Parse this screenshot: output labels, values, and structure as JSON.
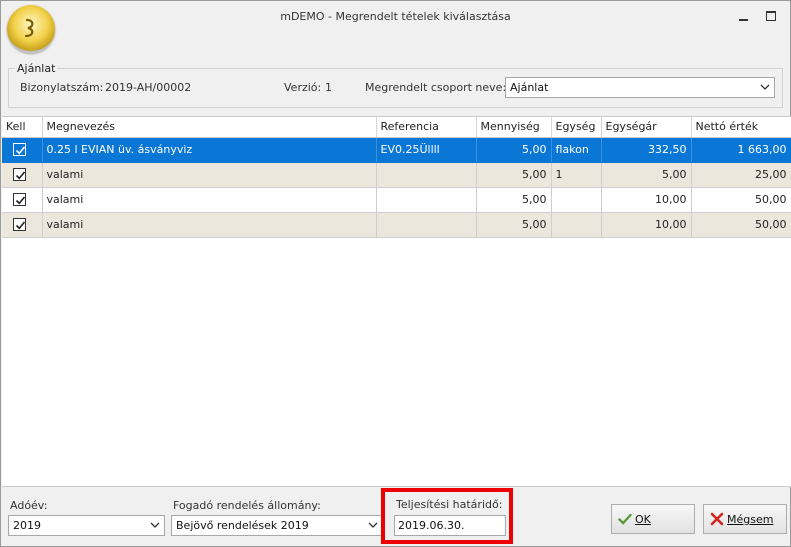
{
  "window": {
    "title": "mDEMO - Megrendelt tételek kiválasztása"
  },
  "offer": {
    "group_label": "Ajánlat",
    "doc_number_label": "Bizonylatszám:",
    "doc_number_value": "2019-AH/00002",
    "version_label": "Verzió:",
    "version_value": "1",
    "group_name_label": "Megrendelt csoport neve:",
    "group_name_value": "Ajánlat"
  },
  "grid": {
    "columns": [
      "Kell",
      "Megnevezés",
      "Referencia",
      "Mennyiség",
      "Egység",
      "Egységár",
      "Nettó érték"
    ],
    "rows": [
      {
        "kell": true,
        "name": "0.25 l EVIAN üv. ásványviz",
        "ref": "EV0.25Üllll",
        "qty": "5,00",
        "unit": "flakon",
        "price": "332,50",
        "net": "1 663,00"
      },
      {
        "kell": true,
        "name": "valami",
        "ref": "",
        "qty": "5,00",
        "unit": "1",
        "price": "5,00",
        "net": "25,00"
      },
      {
        "kell": true,
        "name": "valami",
        "ref": "",
        "qty": "5,00",
        "unit": "",
        "price": "10,00",
        "net": "50,00"
      },
      {
        "kell": true,
        "name": "valami",
        "ref": "",
        "qty": "5,00",
        "unit": "",
        "price": "10,00",
        "net": "50,00"
      }
    ]
  },
  "footer": {
    "tax_year_label": "Adóév:",
    "tax_year_value": "2019",
    "receiving_label": "Fogadó rendelés állomány:",
    "receiving_value": "Bejövő rendelések 2019",
    "deadline_label": "Teljesítési határidő:",
    "deadline_value": "2019.06.30.",
    "ok_label": "OK",
    "cancel_label": "Mégsem"
  },
  "colors": {
    "selection": "#0a77d6",
    "alt_row": "#ece7dd",
    "highlight_box": "#ee0000"
  }
}
